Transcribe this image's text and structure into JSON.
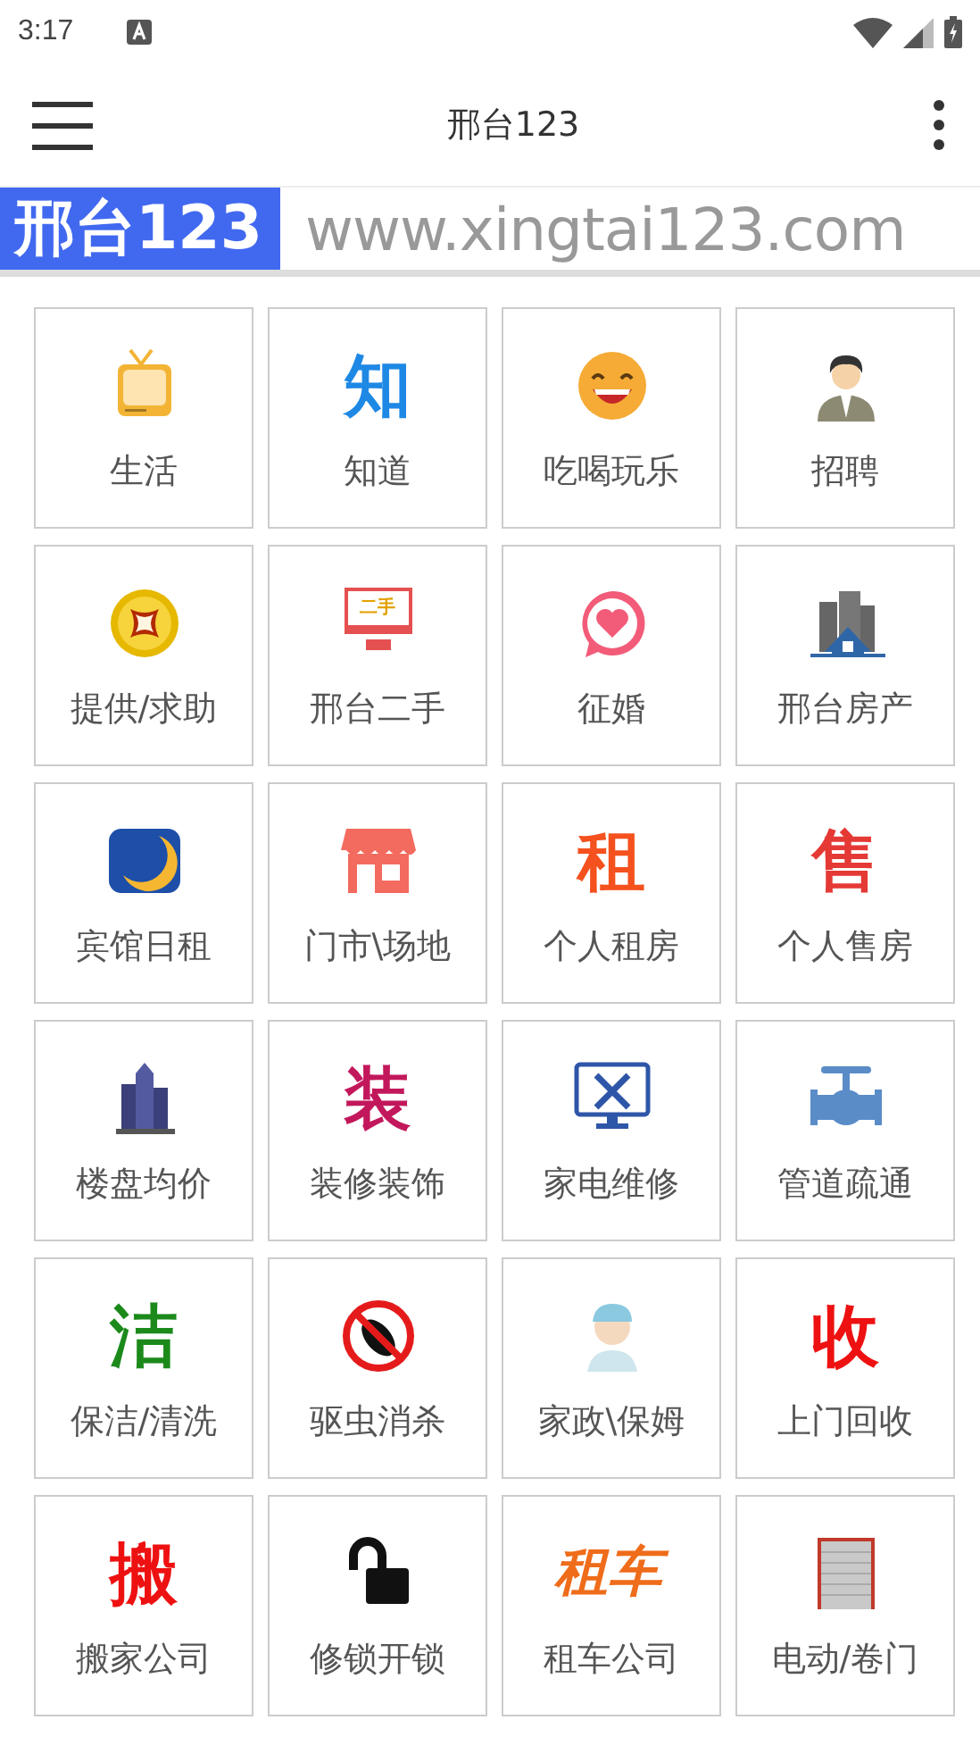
{
  "status_bar": {
    "time": "3:17"
  },
  "app_bar": {
    "title": "邢台123"
  },
  "banner": {
    "logo": "邢台123",
    "url": "www.xingtai123.com"
  },
  "categories": [
    {
      "label": "生活",
      "kind": "tv"
    },
    {
      "label": "知道",
      "kind": "glyph",
      "glyph": "知",
      "color": "#1e88e5"
    },
    {
      "label": "吃喝玩乐",
      "kind": "smile"
    },
    {
      "label": "招聘",
      "kind": "person"
    },
    {
      "label": "提供/求助",
      "kind": "coin"
    },
    {
      "label": "邢台二手",
      "kind": "monitor",
      "glyph": "二手"
    },
    {
      "label": "征婚",
      "kind": "heart-chat"
    },
    {
      "label": "邢台房产",
      "kind": "house"
    },
    {
      "label": "宾馆日租",
      "kind": "moon"
    },
    {
      "label": "门市\\场地",
      "kind": "shop"
    },
    {
      "label": "个人租房",
      "kind": "glyph",
      "glyph": "租",
      "color": "#f4511e"
    },
    {
      "label": "个人售房",
      "kind": "glyph",
      "glyph": "售",
      "color": "#e53935"
    },
    {
      "label": "楼盘均价",
      "kind": "towers"
    },
    {
      "label": "装修装饰",
      "kind": "glyph",
      "glyph": "装",
      "color": "#c2185b"
    },
    {
      "label": "家电维修",
      "kind": "repair"
    },
    {
      "label": "管道疏通",
      "kind": "pipe"
    },
    {
      "label": "保洁/清洗",
      "kind": "glyph",
      "glyph": "洁",
      "color": "#1b8a1b"
    },
    {
      "label": "驱虫消杀",
      "kind": "nobug"
    },
    {
      "label": "家政\\保姆",
      "kind": "figure"
    },
    {
      "label": "上门回收",
      "kind": "glyph",
      "glyph": "收",
      "color": "#ee1111"
    },
    {
      "label": "搬家公司",
      "kind": "glyph",
      "glyph": "搬",
      "color": "#ee1111"
    },
    {
      "label": "修锁开锁",
      "kind": "lock"
    },
    {
      "label": "租车公司",
      "kind": "glyph",
      "glyph": "租车",
      "color": "#ef6c1a"
    },
    {
      "label": "电动/卷门",
      "kind": "shutter"
    }
  ]
}
